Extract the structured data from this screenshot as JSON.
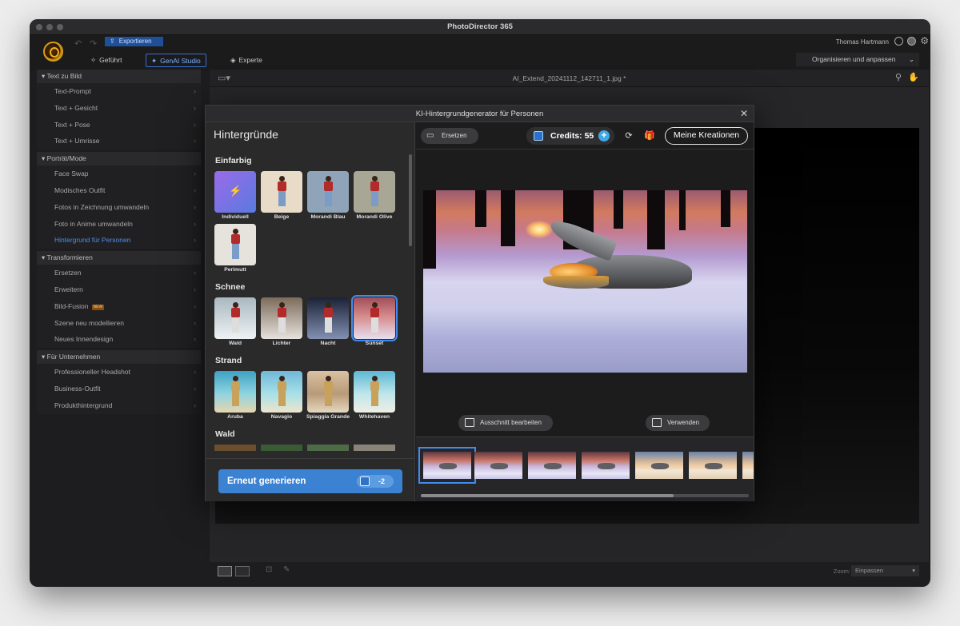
{
  "app": {
    "title": "PhotoDirector 365"
  },
  "toolbar": {
    "export_label": "Exportieren",
    "user_name": "Thomas Hartmann",
    "modes": [
      {
        "label": "Geführt",
        "active": false
      },
      {
        "label": "GenAI Studio",
        "active": true
      },
      {
        "label": "Experte",
        "active": false
      }
    ],
    "organize_label": "Organisieren und anpassen"
  },
  "sidebar": {
    "sections": [
      {
        "title": "Text zu Bild",
        "items": [
          {
            "label": "Text-Prompt"
          },
          {
            "label": "Text + Gesicht"
          },
          {
            "label": "Text + Pose"
          },
          {
            "label": "Text + Umrisse"
          }
        ]
      },
      {
        "title": "Porträt/Mode",
        "items": [
          {
            "label": "Face Swap"
          },
          {
            "label": "Modisches Outfit"
          },
          {
            "label": "Fotos in Zeichnung umwandeln"
          },
          {
            "label": "Foto in Anime umwandeln"
          },
          {
            "label": "Hintergrund für Personen",
            "active": true
          }
        ]
      },
      {
        "title": "Transformieren",
        "items": [
          {
            "label": "Ersetzen"
          },
          {
            "label": "Erweitern"
          },
          {
            "label": "Bild-Fusion",
            "badge": "NEW"
          },
          {
            "label": "Szene neu modellieren"
          },
          {
            "label": "Neues Innendesign"
          }
        ]
      },
      {
        "title": "Für Unternehmen",
        "items": [
          {
            "label": "Professioneller Headshot"
          },
          {
            "label": "Business-Outfit"
          },
          {
            "label": "Produkthintergrund"
          }
        ]
      }
    ]
  },
  "editor": {
    "filename": "AI_Extend_20241112_142711_1.jpg *",
    "zoom_label": "Zoom:",
    "zoom_value": "Einpassen"
  },
  "dialog": {
    "title": "KI-Hintergrundgenerator für Personen",
    "panel_title": "Hintergründe",
    "categories": [
      {
        "name": "Einfarbig",
        "items": [
          {
            "label": "Individuell",
            "color": "#8a6bd8"
          },
          {
            "label": "Beige",
            "color": "#e8dcc8"
          },
          {
            "label": "Morandi Blau",
            "color": "#8fa4b8"
          },
          {
            "label": "Morandi Olive",
            "color": "#a8a694"
          },
          {
            "label": "Perlmutt",
            "color": "#e6e3dc"
          }
        ]
      },
      {
        "name": "Schnee",
        "items": [
          {
            "label": "Wald",
            "color": "#cfd8de"
          },
          {
            "label": "Lichter",
            "color": "#c9b9a6"
          },
          {
            "label": "Nacht",
            "color": "#2a3248"
          },
          {
            "label": "Sunset",
            "color": "#c47d7a",
            "selected": true
          }
        ]
      },
      {
        "name": "Strand",
        "items": [
          {
            "label": "Aruba",
            "color": "#5fb0c8"
          },
          {
            "label": "Navagio",
            "color": "#7dbfd2"
          },
          {
            "label": "Spiaggia Grande",
            "color": "#c4a882"
          },
          {
            "label": "Whitehaven",
            "color": "#8fc6d8"
          }
        ]
      },
      {
        "name": "Wald",
        "items": []
      }
    ],
    "regenerate_label": "Erneut generieren",
    "regenerate_cost": "-2",
    "replace_label": "Ersetzen",
    "credits_label": "Credits: 55",
    "my_creations_label": "Meine Kreationen",
    "edit_crop_label": "Ausschnitt bearbeiten",
    "use_label": "Verwenden",
    "thumbnail_count": 7
  }
}
